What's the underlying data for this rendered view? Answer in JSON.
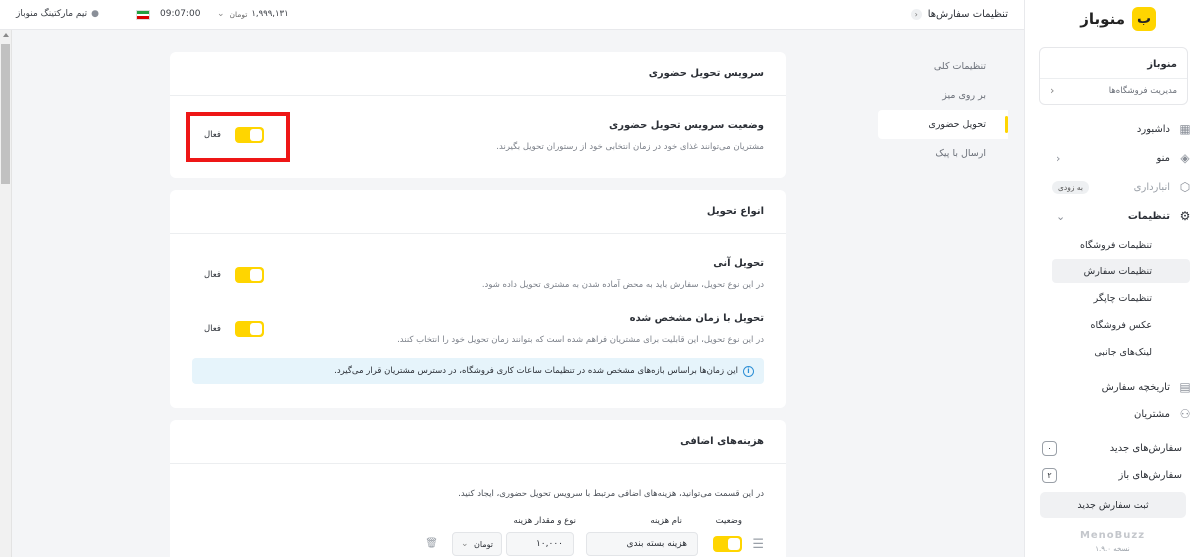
{
  "topbar": {
    "breadcrumb": "تنظیمات سفارش‌ها",
    "balance": "۱,۹۹۹,۱۳۱",
    "currency": "تومان",
    "time": "09:07:00",
    "user": "تیم مارکتینگ منوباز"
  },
  "sidebar": {
    "logo_mark": "ب",
    "logo_text": "منوباز",
    "store_name": "منوباز",
    "store_manage": "مدیریت فروشگاه‌ها",
    "nav": {
      "dashboard": "داشبورد",
      "menu": "منو",
      "inventory": "انبارداری",
      "inventory_badge": "به زودی",
      "settings": "تنظیمات",
      "order_history": "تاریخچه سفارش",
      "customers": "مشتریان"
    },
    "settings_sub": [
      "تنظیمات فروشگاه",
      "تنظیمات سفارش",
      "تنظیمات چاپگر",
      "عکس فروشگاه",
      "لینک‌های جانبی"
    ],
    "new_orders_label": "سفارش‌های جدید",
    "new_orders_count": "۰",
    "open_orders_label": "سفارش‌های باز",
    "open_orders_count": "۲",
    "new_order_button": "ثبت سفارش جدید",
    "brand": "MenoBuzz",
    "version": "نسخه ۱.۹.۰"
  },
  "subnav": [
    "تنظیمات کلی",
    "بر روی میز",
    "تحویل حضوری",
    "ارسال با پیک"
  ],
  "card1": {
    "title": "سرویس تحویل حضوری",
    "row_title": "وضعیت سرویس تحویل حضوری",
    "row_desc": "مشتریان می‌توانند غذای خود در زمان انتخابی خود از رستوران تحویل بگیرند.",
    "toggle_label": "فعال"
  },
  "card2": {
    "title": "انواع تحویل",
    "instant_title": "تحویل آنی",
    "instant_desc": "در این نوع تحویل، سفارش باید به محض آماده شدن به مشتری تحویل داده شود.",
    "scheduled_title": "تحویل با زمان مشخص شده",
    "scheduled_desc": "در این نوع تحویل، این قابلیت برای مشتریان فراهم شده است که بتوانند زمان تحویل خود را انتخاب کنند.",
    "toggle_label": "فعال",
    "info": "این زمان‌ها براساس بازه‌های مشخص شده در تنظیمات ساعات کاری فروشگاه، در دسترس مشتریان قرار می‌گیرد."
  },
  "card3": {
    "title": "هزینه‌های اضافی",
    "desc": "در این قسمت می‌توانید، هزینه‌های اضافی مرتبط با سرویس تحویل حضوری، ایجاد کنید.",
    "col_status": "وضعیت",
    "col_name": "نام هزینه",
    "col_type": "نوع و مقدار هزینه",
    "row_name": "هزینه بسته بندی",
    "row_amount": "۱۰,۰۰۰",
    "row_unit": "تومان"
  }
}
